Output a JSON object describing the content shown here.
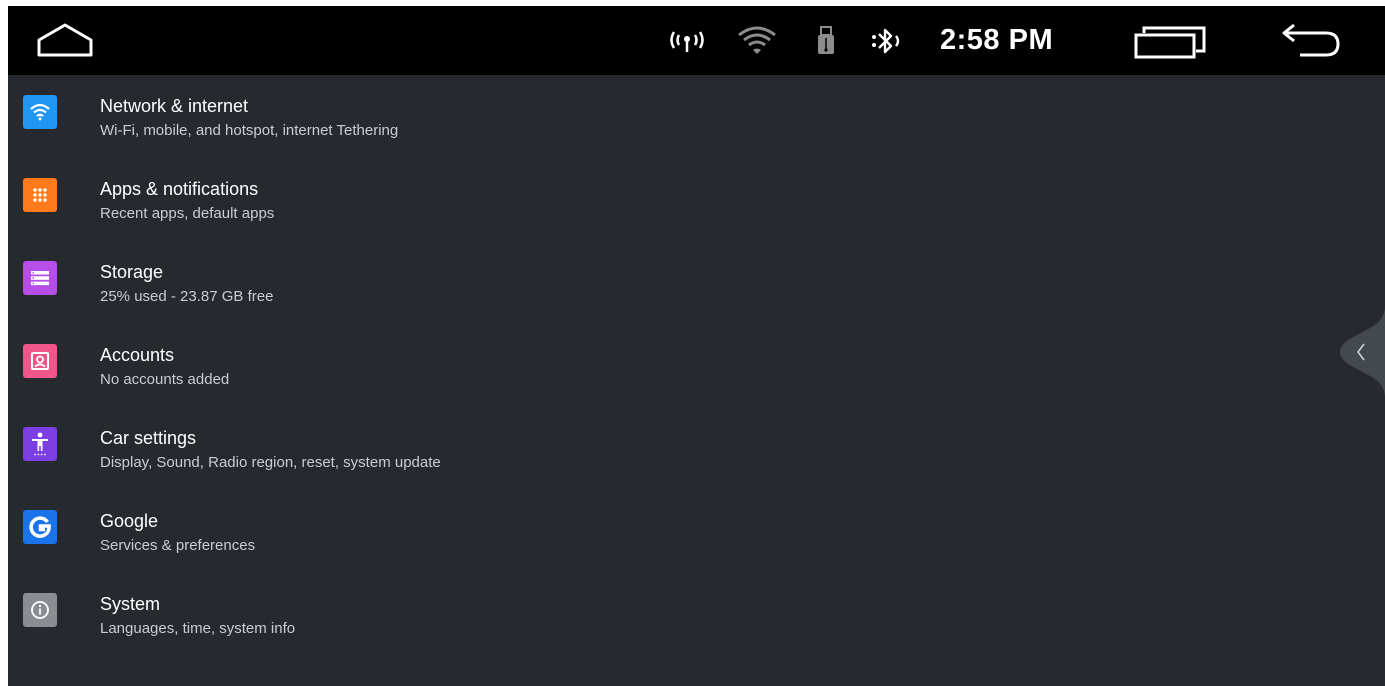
{
  "status_bar": {
    "time": "2:58 PM",
    "icons": [
      "home-outline-icon",
      "hotspot-icon",
      "wifi-icon",
      "usb-icon",
      "bluetooth-icon",
      "recents-icon",
      "back-icon"
    ]
  },
  "settings": [
    {
      "key": "network",
      "title": "Network & internet",
      "subtitle": "Wi-Fi, mobile, and hotspot, internet Tethering",
      "icon": "wifi-icon",
      "color": "#2196f3"
    },
    {
      "key": "apps",
      "title": "Apps & notifications",
      "subtitle": "Recent apps, default apps",
      "icon": "apps-grid-icon",
      "color": "#ff7a1a"
    },
    {
      "key": "storage",
      "title": "Storage",
      "subtitle": "25% used - 23.87 GB free",
      "icon": "storage-icon",
      "color": "#b74ee8"
    },
    {
      "key": "accounts",
      "title": "Accounts",
      "subtitle": "No accounts added",
      "icon": "account-box-icon",
      "color": "#f0568a"
    },
    {
      "key": "car",
      "title": "Car settings",
      "subtitle": "Display, Sound, Radio region, reset, system update",
      "icon": "accessibility-icon",
      "color": "#7b3fe4"
    },
    {
      "key": "google",
      "title": "Google",
      "subtitle": "Services & preferences",
      "icon": "google-g-icon",
      "color": "#1a73e8"
    },
    {
      "key": "system",
      "title": "System",
      "subtitle": "Languages, time, system info",
      "icon": "info-icon",
      "color": "#8a8e92"
    }
  ],
  "side_handle": {
    "icon": "chevron-left-icon"
  },
  "colors": {
    "background": "#262a2e",
    "status_bar": "#000000",
    "text_primary": "#ffffff",
    "text_secondary": "#c9cdd1"
  }
}
